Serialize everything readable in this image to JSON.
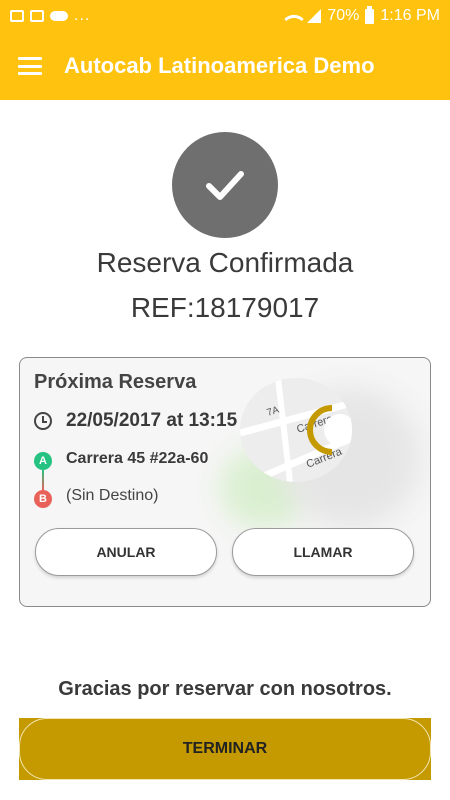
{
  "status_bar": {
    "battery": "70%",
    "time": "1:16 PM",
    "left_icons": [
      "image-icon",
      "phone-lock-icon",
      "weather-icon"
    ],
    "more": "..."
  },
  "app_bar": {
    "title": "Autocab Latinoamerica Demo",
    "menu_icon": "hamburger-menu-icon",
    "color": "#ffc20e"
  },
  "confirmation": {
    "title": "Reserva Confirmada",
    "reference": "REF:18179017",
    "icon": "check-icon"
  },
  "booking_card": {
    "title": "Próxima Reserva",
    "datetime": "22/05/2017 at 13:15",
    "pickup_label": "A",
    "pickup_address": "Carrera 45 #22a-60",
    "dropoff_label": "B",
    "dropoff_address": "(Sin Destino)",
    "cancel_button": "ANULAR",
    "call_button": "LLAMAR",
    "map_labels": [
      "Carrera",
      "Carrera",
      "7A"
    ]
  },
  "footer": {
    "thanks": "Gracias por reservar con nosotros.",
    "finish_button": "TERMINAR"
  },
  "colors": {
    "accent": "#ffc20e",
    "finish": "#c49a00",
    "pickup": "#26c281",
    "dropoff": "#e8625a"
  }
}
